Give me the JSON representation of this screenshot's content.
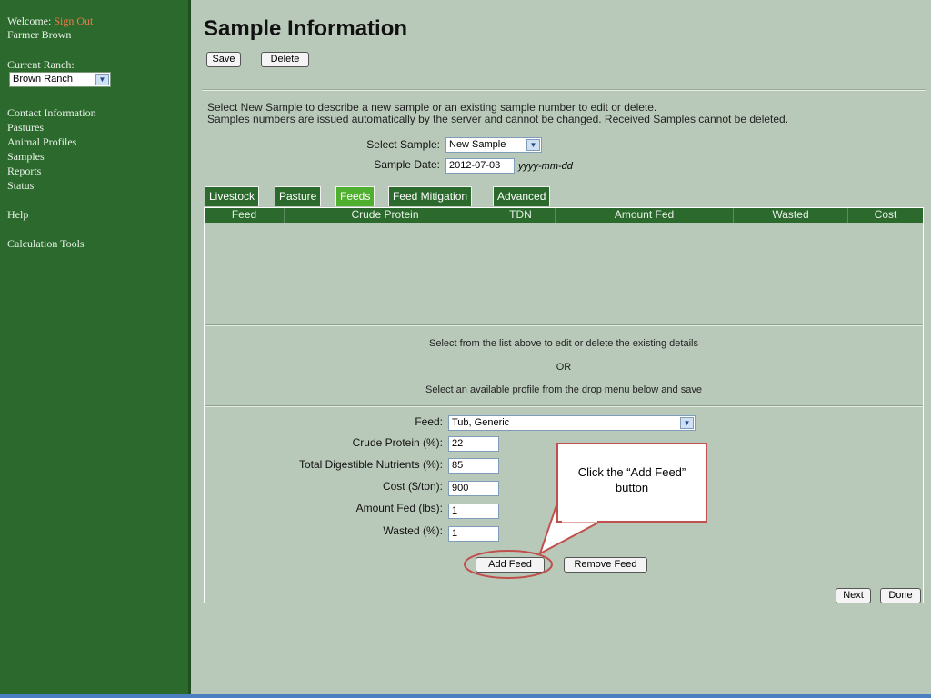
{
  "sidebar": {
    "welcome_label": "Welcome:",
    "sign_out": "Sign Out",
    "user": "Farmer Brown",
    "current_ranch_label": "Current Ranch:",
    "current_ranch_value": "Brown Ranch",
    "nav": [
      "Contact Information",
      "Pastures",
      "Animal Profiles",
      "Samples",
      "Reports",
      "Status"
    ],
    "help": "Help",
    "calc_tools": "Calculation Tools"
  },
  "main": {
    "title": "Sample Information",
    "save_label": "Save",
    "delete_label": "Delete",
    "info_line1": "Select New Sample to describe a new sample or an existing sample number to edit or delete.",
    "info_line2": "Samples numbers are issued automatically by the server and cannot be changed. Received Samples cannot be deleted.",
    "select_sample_label": "Select Sample:",
    "select_sample_value": "New Sample",
    "sample_date_label": "Sample Date:",
    "sample_date_value": "2012-07-03",
    "sample_date_hint": "yyyy-mm-dd"
  },
  "tabs": [
    {
      "label": "Livestock"
    },
    {
      "label": "Pasture"
    },
    {
      "label": "Feeds",
      "active": true
    },
    {
      "label": "Feed Mitigation"
    },
    {
      "label": "Advanced"
    }
  ],
  "table": {
    "columns": [
      "Feed",
      "Crude Protein",
      "TDN",
      "Amount Fed",
      "Wasted",
      "Cost"
    ]
  },
  "instructions": {
    "line1": "Select from the list above to edit or delete the existing details",
    "line2": "OR",
    "line3": "Select an available profile from the drop menu below and save"
  },
  "form": {
    "feed_label": "Feed:",
    "feed_value": "Tub, Generic",
    "crude_protein_label": "Crude Protein (%):",
    "crude_protein_value": "22",
    "tdn_label": "Total Digestible Nutrients (%):",
    "tdn_value": "85",
    "cost_label": "Cost ($/ton):",
    "cost_value": "900",
    "amount_label": "Amount Fed (lbs):",
    "amount_value": "1",
    "wasted_label": "Wasted (%):",
    "wasted_value": "1",
    "add_feed": "Add Feed",
    "remove_feed": "Remove Feed",
    "next": "Next",
    "done": "Done"
  },
  "callout": {
    "line1": "Click the “Add Feed”",
    "line2": "button",
    "color": "#c0504d"
  },
  "colors": {
    "sidebar": "#2b6a2c",
    "active_tab": "#4faf2f",
    "background": "#b9c9b9",
    "sign_out": "#f47a4a"
  }
}
